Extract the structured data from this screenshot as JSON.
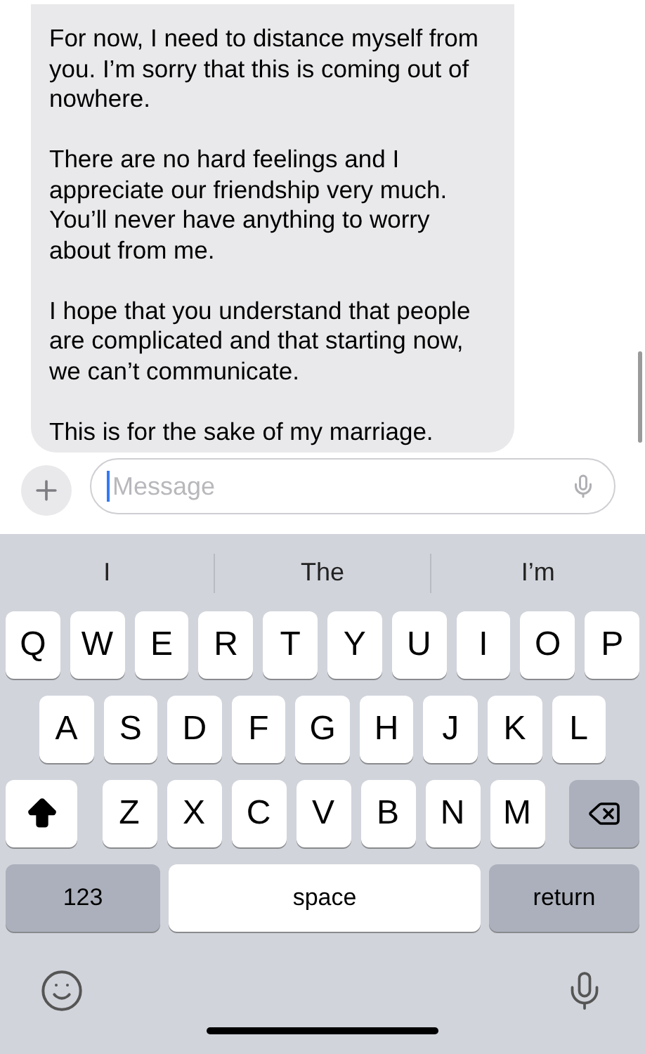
{
  "conversation": {
    "message": {
      "paragraphs": [
        [
          "For now, I need to distance myself from",
          "you. I’m sorry that this is coming out of",
          "nowhere."
        ],
        [
          "There are no hard feelings and I",
          "appreciate our friendship very much.",
          "You’ll never have anything to worry",
          "about from me."
        ],
        [
          "I hope that you understand that people",
          "are complicated and that starting now,",
          "we can’t communicate."
        ],
        [
          "This is for the sake of my marriage."
        ]
      ]
    }
  },
  "composer": {
    "placeholder": "Message"
  },
  "keyboard": {
    "suggestions": [
      "I",
      "The",
      "I’m"
    ],
    "rows": [
      [
        "Q",
        "W",
        "E",
        "R",
        "T",
        "Y",
        "U",
        "I",
        "O",
        "P"
      ],
      [
        "A",
        "S",
        "D",
        "F",
        "G",
        "H",
        "J",
        "K",
        "L"
      ],
      [
        "Z",
        "X",
        "C",
        "V",
        "B",
        "N",
        "M"
      ]
    ],
    "shift_on": true,
    "bottom_row": [
      "123",
      "space",
      "return"
    ]
  }
}
